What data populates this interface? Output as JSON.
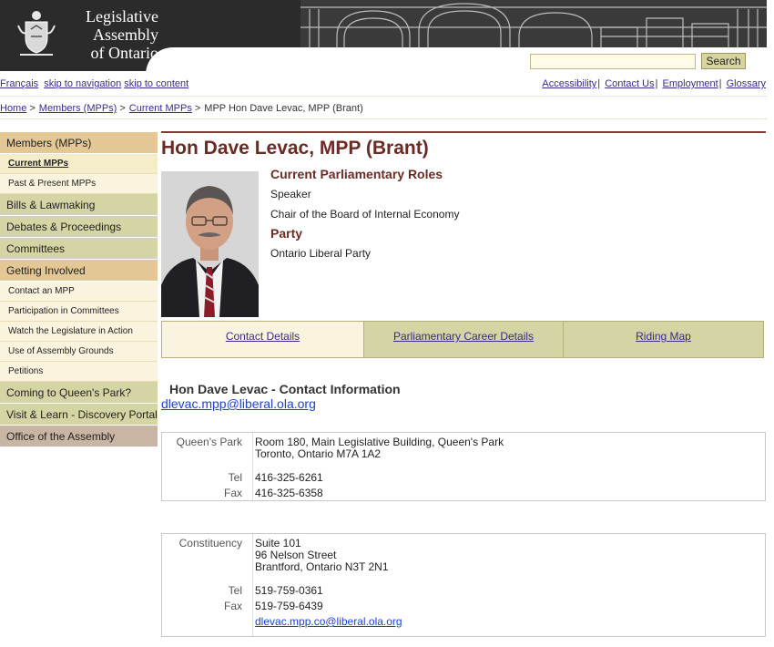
{
  "header": {
    "logo_lines": [
      "Legislative",
      "Assembly",
      "of Ontario"
    ],
    "search_placeholder": "",
    "search_button": "Search"
  },
  "util_links_left": [
    "Français",
    "skip to navigation",
    "skip to content"
  ],
  "util_links_right": [
    "Accessibility",
    "Contact Us",
    "Employment",
    "Glossary"
  ],
  "breadcrumb": {
    "home": "Home",
    "members": "Members (MPPs)",
    "current": "Current MPPs",
    "page": "MPP Hon Dave Levac, MPP (Brant)",
    "sep": ">"
  },
  "sidebar": {
    "items": [
      {
        "label": "Members (MPPs)",
        "style": "orange"
      },
      {
        "label": "Current MPPs",
        "style": "sub-active"
      },
      {
        "label": "Past & Present MPPs",
        "style": "sub"
      },
      {
        "label": "Bills & Lawmaking",
        "style": "green"
      },
      {
        "label": "Debates & Proceedings",
        "style": "green"
      },
      {
        "label": "Committees",
        "style": "green"
      },
      {
        "label": "Getting Involved",
        "style": "orange"
      },
      {
        "label": "Contact an MPP",
        "style": "sub"
      },
      {
        "label": "Participation in Committees",
        "style": "sub"
      },
      {
        "label": "Watch the Legislature in Action",
        "style": "sub"
      },
      {
        "label": "Use of Assembly Grounds",
        "style": "sub"
      },
      {
        "label": "Petitions",
        "style": "sub"
      },
      {
        "label": "Coming to Queen's Park?",
        "style": "green"
      },
      {
        "label": "Visit & Learn - Discovery Portal",
        "style": "green"
      },
      {
        "label": "Office of the Assembly",
        "style": "taupe"
      }
    ]
  },
  "profile": {
    "name": "Hon Dave Levac, MPP (Brant)",
    "roles_heading": "Current Parliamentary Roles",
    "roles": [
      "Speaker",
      "Chair of the Board of Internal Economy"
    ],
    "party_heading": "Party",
    "party": "Ontario Liberal Party"
  },
  "tabs": [
    "Contact Details",
    "Parliamentary Career Details",
    "Riding Map"
  ],
  "contact": {
    "heading": "Hon Dave Levac - Contact Information",
    "email": "dlevac.mpp@liberal.ola.org",
    "queens_park": {
      "label": "Queen's Park",
      "address1": "Room 180, Main Legislative Building, Queen's Park",
      "address2": "Toronto, Ontario M7A 1A2",
      "tel_label": "Tel",
      "tel": "416-325-6261",
      "fax_label": "Fax",
      "fax": "416-325-6358"
    },
    "constituency": {
      "label": "Constituency",
      "address1": "Suite 101",
      "address2": "96 Nelson Street",
      "address3": "Brantford, Ontario N3T 2N1",
      "tel_label": "Tel",
      "tel": "519-759-0361",
      "fax_label": "Fax",
      "fax": "519-759-6439",
      "email": "dlevac.mpp.co@liberal.ola.org"
    }
  },
  "colors": {
    "heading": "#6b2b25",
    "link": "#3a2a8a",
    "nav_orange": "#e3c896",
    "nav_green": "#d4d4a4",
    "nav_sub": "#faf4de"
  }
}
